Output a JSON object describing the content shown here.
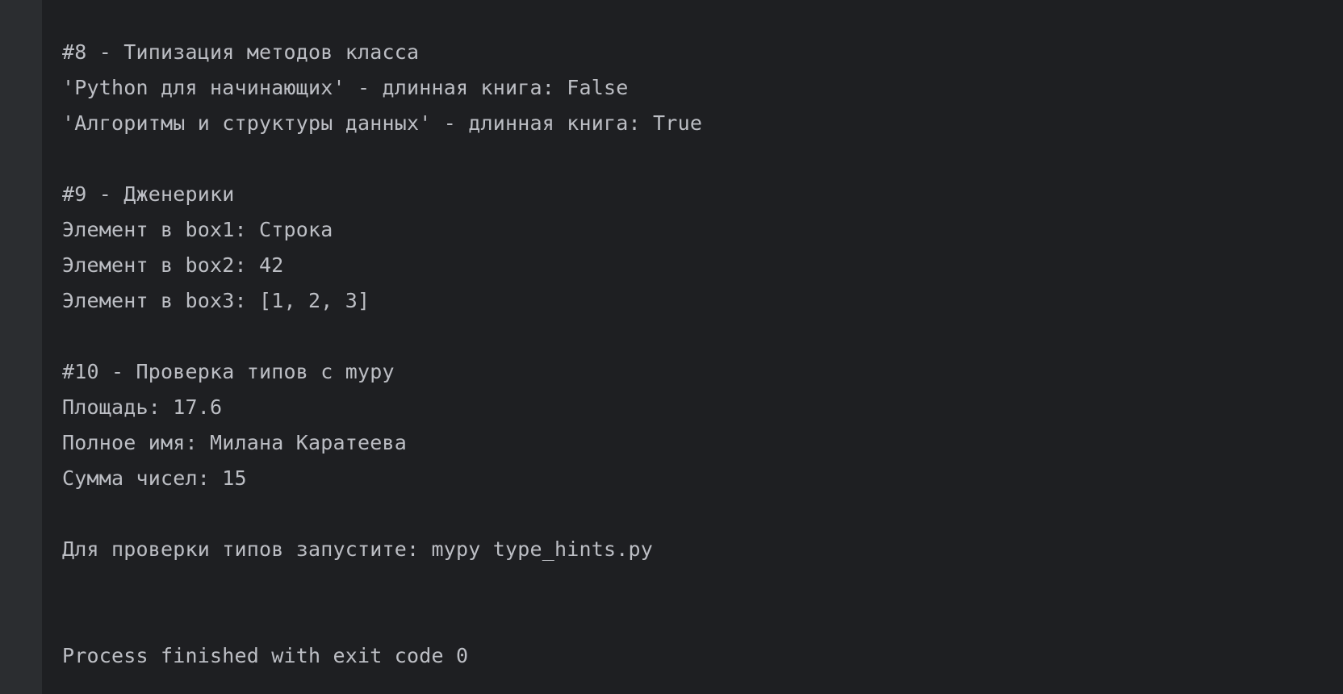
{
  "console": {
    "lines": [
      "#8 - Типизация методов класса",
      "'Python для начинающих' - длинная книга: False",
      "'Алгоритмы и структуры данных' - длинная книга: True",
      "",
      "#9 - Дженерики",
      "Элемент в box1: Строка",
      "Элемент в box2: 42",
      "Элемент в box3: [1, 2, 3]",
      "",
      "#10 - Проверка типов с mypy",
      "Площадь: 17.6",
      "Полное имя: Милана Каратеева",
      "Сумма чисел: 15",
      "",
      "Для проверки типов запустите: mypy type_hints.py",
      "",
      "",
      "Process finished with exit code 0"
    ]
  }
}
